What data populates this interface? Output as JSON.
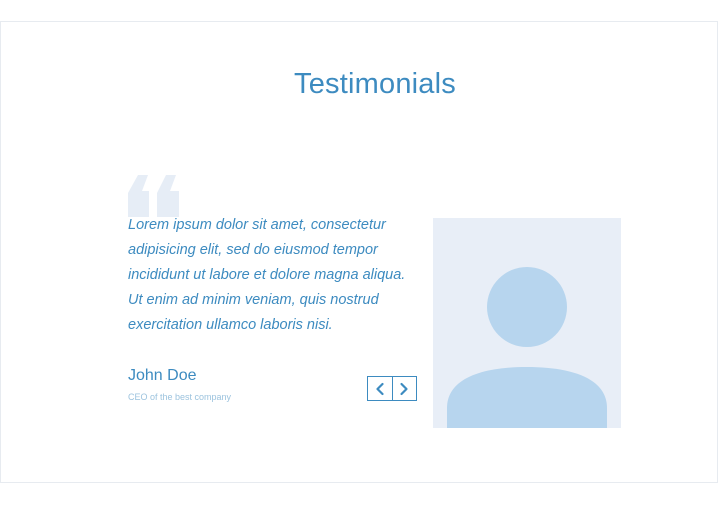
{
  "section": {
    "title": "Testimonials"
  },
  "testimonial": {
    "quote_lines": [
      "Lorem ipsum dolor sit amet, consectetur",
      "adipisicing elit, sed do eiusmod tempor",
      "incididunt ut labore et dolore magna aliqua.",
      "Ut enim ad minim veniam, quis nostrud",
      "exercitation ullamco laboris nisi."
    ],
    "author_name": "John Doe",
    "author_title": "CEO of the best company"
  },
  "icons": {
    "quote": "quote-icon",
    "prev": "chevron-left-icon",
    "next": "chevron-right-icon",
    "avatar": "user-placeholder-icon"
  },
  "colors": {
    "accent": "#3d8bc0",
    "muted": "#9cc3de",
    "quote_icon": "#e6edf6",
    "photo_bg": "#e8eef7",
    "avatar": "#b7d5ee",
    "frame_border": "#e7ebf0"
  }
}
